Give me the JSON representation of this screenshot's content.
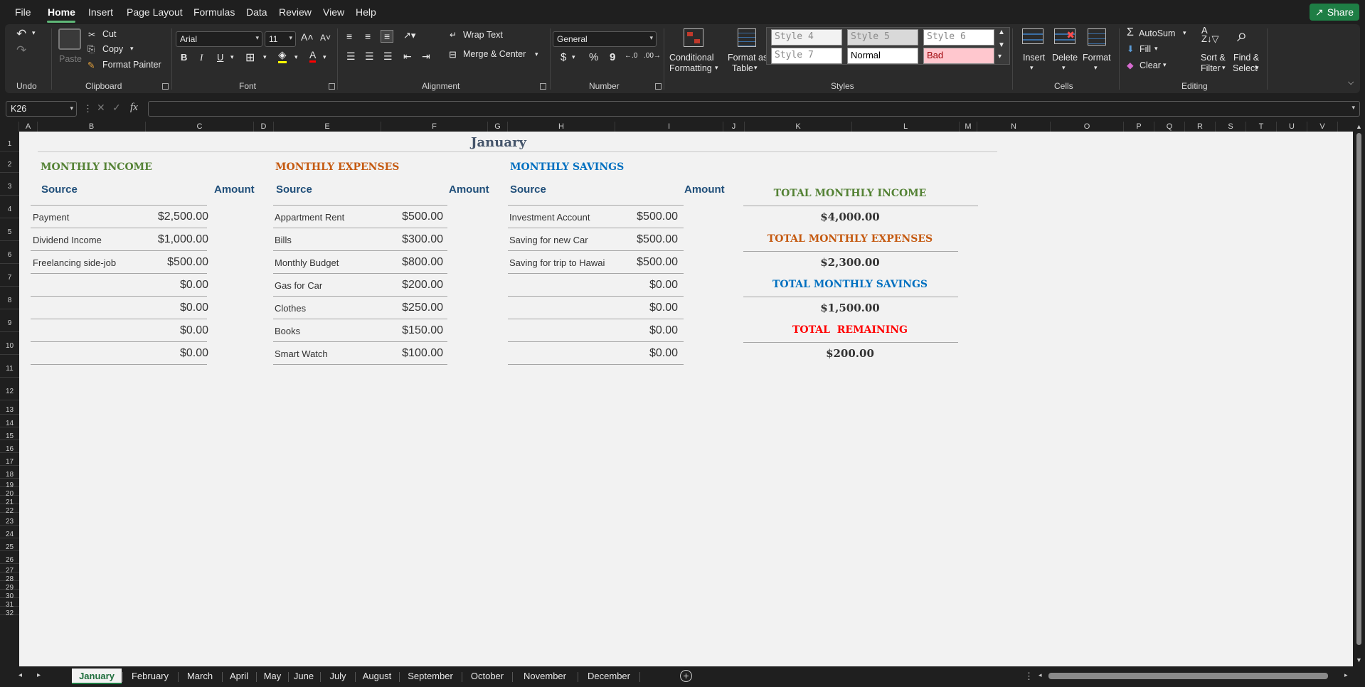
{
  "menu": {
    "items": [
      "File",
      "Home",
      "Insert",
      "Page Layout",
      "Formulas",
      "Data",
      "Review",
      "View",
      "Help"
    ],
    "active": "Home",
    "share_label": "Share"
  },
  "ribbon": {
    "undo": {
      "group_label": "Undo"
    },
    "clipboard": {
      "paste": "Paste",
      "cut": "Cut",
      "copy": "Copy",
      "format_painter": "Format Painter",
      "group_label": "Clipboard"
    },
    "font": {
      "name": "Arial",
      "size": "11",
      "bold": "B",
      "italic": "I",
      "underline": "U",
      "group_label": "Font"
    },
    "alignment": {
      "wrap_text": "Wrap Text",
      "merge_center": "Merge & Center",
      "group_label": "Alignment"
    },
    "number": {
      "format": "General",
      "currency": "$",
      "percent": "%",
      "comma": "9",
      "group_label": "Number"
    },
    "styles": {
      "conditional": [
        "Conditional",
        "Formatting"
      ],
      "format_table": [
        "Format as",
        "Table"
      ],
      "cells": [
        "Style 4",
        "Style 5",
        "Style 6",
        "Style 7",
        "Normal",
        "Bad"
      ],
      "group_label": "Styles"
    },
    "cells": {
      "insert": "Insert",
      "delete": "Delete",
      "format": "Format",
      "group_label": "Cells"
    },
    "editing": {
      "autosum": "AutoSum",
      "fill": "Fill",
      "clear": "Clear",
      "sort": [
        "Sort &",
        "Filter"
      ],
      "find": [
        "Find &",
        "Select"
      ],
      "group_label": "Editing"
    }
  },
  "formula_bar": {
    "name_box": "K26",
    "fx": "fx",
    "formula": ""
  },
  "columns": [
    "A",
    "B",
    "C",
    "D",
    "E",
    "F",
    "G",
    "H",
    "I",
    "J",
    "K",
    "L",
    "M",
    "N",
    "O",
    "P",
    "Q",
    "R",
    "S",
    "T",
    "U",
    "V"
  ],
  "rows": [
    "1",
    "2",
    "3",
    "4",
    "5",
    "6",
    "7",
    "8",
    "9",
    "10",
    "11",
    "12",
    "13",
    "14",
    "15",
    "16",
    "17",
    "18",
    "19",
    "20",
    "21",
    "22",
    "23",
    "24",
    "25",
    "26",
    "27",
    "28",
    "29",
    "30",
    "31",
    "32"
  ],
  "sheet": {
    "title": "January",
    "income": {
      "header": "MONTHLY INCOME",
      "source_label": "Source",
      "amount_label": "Amount",
      "rows": [
        {
          "source": "Payment",
          "amount": "$2,500.00"
        },
        {
          "source": "Dividend Income",
          "amount": "$1,000.00"
        },
        {
          "source": "Freelancing side-job",
          "amount": "$500.00"
        },
        {
          "source": "",
          "amount": "$0.00"
        },
        {
          "source": "",
          "amount": "$0.00"
        },
        {
          "source": "",
          "amount": "$0.00"
        },
        {
          "source": "",
          "amount": "$0.00"
        }
      ]
    },
    "expenses": {
      "header": "MONTHLY EXPENSES",
      "source_label": "Source",
      "amount_label": "Amount",
      "rows": [
        {
          "source": "Appartment Rent",
          "amount": "$500.00"
        },
        {
          "source": "Bills",
          "amount": "$300.00"
        },
        {
          "source": "Monthly Budget",
          "amount": "$800.00"
        },
        {
          "source": "Gas for Car",
          "amount": "$200.00"
        },
        {
          "source": "Clothes",
          "amount": "$250.00"
        },
        {
          "source": "Books",
          "amount": "$150.00"
        },
        {
          "source": "Smart Watch",
          "amount": "$100.00"
        }
      ]
    },
    "savings": {
      "header": "MONTHLY SAVINGS",
      "source_label": "Source",
      "amount_label": "Amount",
      "rows": [
        {
          "source": "Investment Account",
          "amount": "$500.00"
        },
        {
          "source": "Saving for new Car",
          "amount": "$500.00"
        },
        {
          "source": "Saving for trip to Hawai",
          "amount": "$500.00"
        },
        {
          "source": "",
          "amount": "$0.00"
        },
        {
          "source": "",
          "amount": "$0.00"
        },
        {
          "source": "",
          "amount": "$0.00"
        },
        {
          "source": "",
          "amount": "$0.00"
        }
      ]
    },
    "totals": {
      "income_label": "TOTAL MONTHLY INCOME",
      "income_value": "$4,000.00",
      "expenses_label": "TOTAL MONTHLY EXPENSES",
      "expenses_value": "$2,300.00",
      "savings_label": "TOTAL MONTHLY SAVINGS",
      "savings_value": "$1,500.00",
      "remaining_label": "TOTAL  REMAINING",
      "remaining_value": "$200.00"
    }
  },
  "tabs": [
    "January",
    "February",
    "March",
    "April",
    "May",
    "June",
    "July",
    "August",
    "September",
    "October",
    "November",
    "December"
  ],
  "active_tab": "January",
  "colors": {
    "income": "#548235",
    "expenses": "#c55a11",
    "savings": "#0070c0",
    "remaining": "#ff0000",
    "accent": "#1e7e45"
  }
}
